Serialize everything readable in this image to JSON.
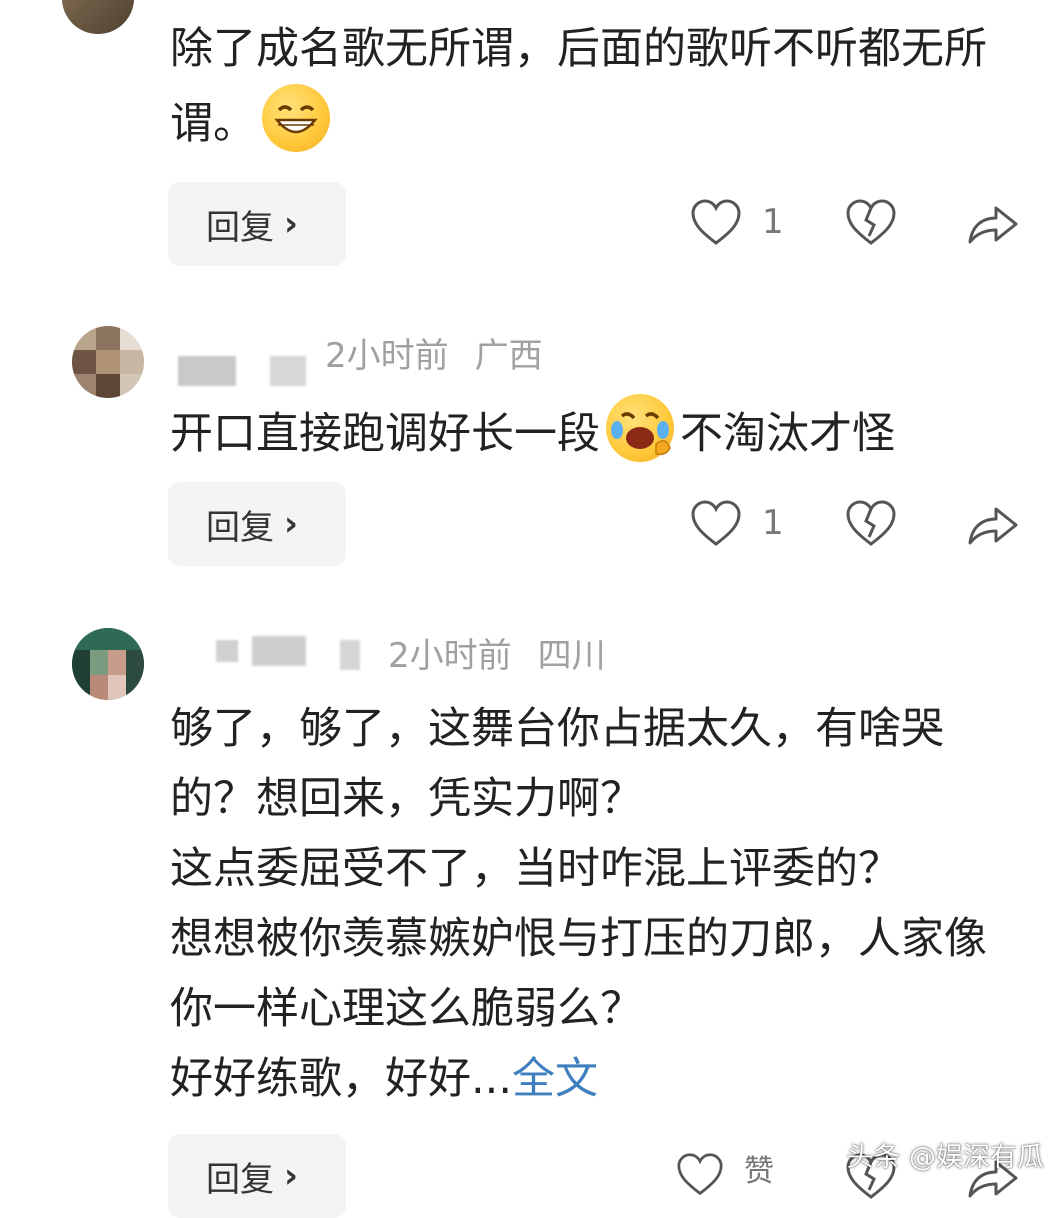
{
  "comments": [
    {
      "text_lines": [
        "除了成名歌无所谓，后面的歌听不听都无所",
        "谓。"
      ],
      "emoji": "grinning-face-emoji",
      "reply_label": "回复",
      "reply_chevron": "›",
      "like_count": "1"
    },
    {
      "time": "2小时前",
      "location": "广西",
      "text_before": "开口直接跑调好长一段",
      "emoji": "rolling-on-floor-laughing-emoji",
      "text_after": "不淘汰才怪",
      "reply_label": "回复",
      "reply_chevron": "›",
      "like_count": "1"
    },
    {
      "time": "2小时前",
      "location": "四川",
      "text_lines": [
        "够了，够了，这舞台你占据太久，有啥哭",
        "的？想回来，凭实力啊？",
        "这点委屈受不了，当时咋混上评委的？",
        "想想被你羡慕嫉妒恨与打压的刀郎，人家像",
        "你一样心理这么脆弱么？"
      ],
      "last_line_prefix": "好好练歌，好好...",
      "full_text_link": "全文",
      "reply_label": "回复",
      "reply_chevron": "›",
      "like_label": "赞"
    }
  ],
  "watermark": "头条 @娱深有瓜",
  "colors": {
    "link": "#3f7fbf",
    "meta": "#a0a0a0",
    "text": "#222222",
    "reply_bg": "#f4f4f4"
  }
}
